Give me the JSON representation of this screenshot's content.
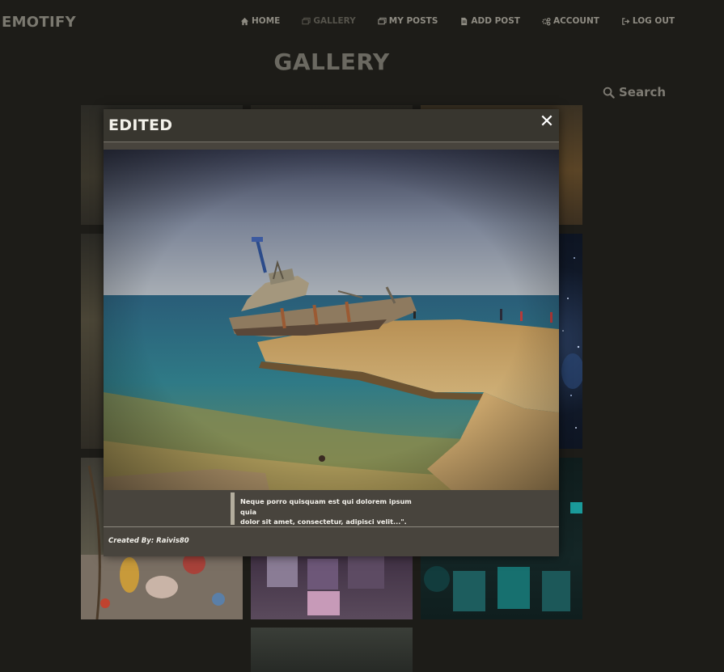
{
  "brand": "EMOTIFY",
  "nav": {
    "items": [
      {
        "label": "HOME",
        "icon": "home-icon"
      },
      {
        "label": "GALLERY",
        "icon": "images-icon",
        "active": true
      },
      {
        "label": "MY POSTS",
        "icon": "images-icon"
      },
      {
        "label": "ADD POST",
        "icon": "file-icon"
      },
      {
        "label": "ACCOUNT",
        "icon": "gears-icon"
      },
      {
        "label": "LOG OUT",
        "icon": "sign-out-icon"
      }
    ]
  },
  "page_title": "GALLERY",
  "search": {
    "label": "Search",
    "icon": "search-icon"
  },
  "modal": {
    "title": "EDITED",
    "close_icon": "close-icon",
    "image_alt": "Shipwreck beside rocky shore",
    "description_line1": "Neque porro quisquam est qui dolorem ipsum quia",
    "description_line2": "dolor sit amet, consectetur, adipisci velit...\".",
    "created_by": "Created By: Raivis80"
  },
  "colors": {
    "background": "#1d1c18",
    "modal": "#48443d",
    "modal_header": "#38362f"
  }
}
